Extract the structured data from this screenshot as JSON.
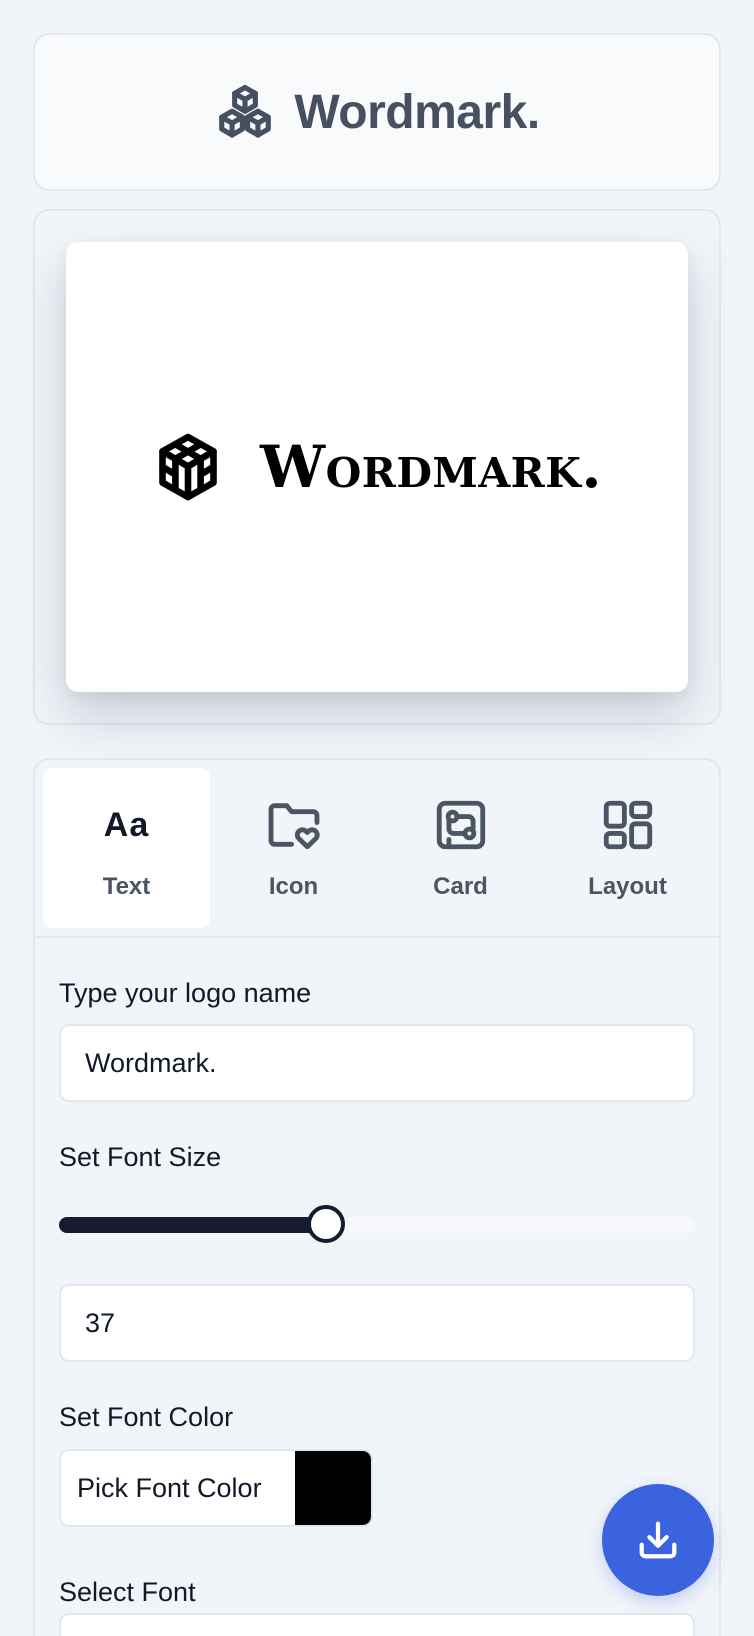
{
  "header": {
    "title": "Wordmark.",
    "icon": "cubes-icon"
  },
  "preview": {
    "logo_text": "Wordmark.",
    "logo_icon": "cube-icon",
    "text_color": "#000000"
  },
  "tabs": [
    {
      "label": "Text",
      "icon": "text-aa-icon",
      "glyph": "Aa",
      "active": true
    },
    {
      "label": "Icon",
      "icon": "folder-heart-icon",
      "active": false
    },
    {
      "label": "Card",
      "icon": "card-circuit-icon",
      "active": false
    },
    {
      "label": "Layout",
      "icon": "layout-grid-icon",
      "active": false
    }
  ],
  "form": {
    "name_label": "Type your logo name",
    "name_value": "Wordmark.",
    "size_label": "Set Font Size",
    "size_value": "37",
    "size_fraction": 0.42,
    "color_label": "Set Font Color",
    "color_button_label": "Pick Font Color",
    "color_value": "#000000",
    "font_label": "Select Font"
  },
  "fab": {
    "icon": "download-icon"
  },
  "colors": {
    "accent": "#3b63e0",
    "slider": "#161b2e"
  }
}
